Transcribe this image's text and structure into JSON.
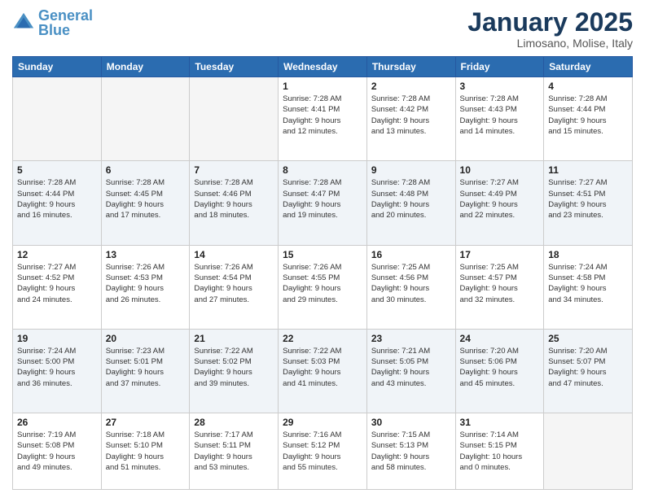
{
  "logo": {
    "text_general": "General",
    "text_blue": "Blue"
  },
  "header": {
    "month_title": "January 2025",
    "location": "Limosano, Molise, Italy"
  },
  "weekdays": [
    "Sunday",
    "Monday",
    "Tuesday",
    "Wednesday",
    "Thursday",
    "Friday",
    "Saturday"
  ],
  "weeks": [
    {
      "days": [
        {
          "num": "",
          "info": ""
        },
        {
          "num": "",
          "info": ""
        },
        {
          "num": "",
          "info": ""
        },
        {
          "num": "1",
          "info": "Sunrise: 7:28 AM\nSunset: 4:41 PM\nDaylight: 9 hours\nand 12 minutes."
        },
        {
          "num": "2",
          "info": "Sunrise: 7:28 AM\nSunset: 4:42 PM\nDaylight: 9 hours\nand 13 minutes."
        },
        {
          "num": "3",
          "info": "Sunrise: 7:28 AM\nSunset: 4:43 PM\nDaylight: 9 hours\nand 14 minutes."
        },
        {
          "num": "4",
          "info": "Sunrise: 7:28 AM\nSunset: 4:44 PM\nDaylight: 9 hours\nand 15 minutes."
        }
      ]
    },
    {
      "days": [
        {
          "num": "5",
          "info": "Sunrise: 7:28 AM\nSunset: 4:44 PM\nDaylight: 9 hours\nand 16 minutes."
        },
        {
          "num": "6",
          "info": "Sunrise: 7:28 AM\nSunset: 4:45 PM\nDaylight: 9 hours\nand 17 minutes."
        },
        {
          "num": "7",
          "info": "Sunrise: 7:28 AM\nSunset: 4:46 PM\nDaylight: 9 hours\nand 18 minutes."
        },
        {
          "num": "8",
          "info": "Sunrise: 7:28 AM\nSunset: 4:47 PM\nDaylight: 9 hours\nand 19 minutes."
        },
        {
          "num": "9",
          "info": "Sunrise: 7:28 AM\nSunset: 4:48 PM\nDaylight: 9 hours\nand 20 minutes."
        },
        {
          "num": "10",
          "info": "Sunrise: 7:27 AM\nSunset: 4:49 PM\nDaylight: 9 hours\nand 22 minutes."
        },
        {
          "num": "11",
          "info": "Sunrise: 7:27 AM\nSunset: 4:51 PM\nDaylight: 9 hours\nand 23 minutes."
        }
      ]
    },
    {
      "days": [
        {
          "num": "12",
          "info": "Sunrise: 7:27 AM\nSunset: 4:52 PM\nDaylight: 9 hours\nand 24 minutes."
        },
        {
          "num": "13",
          "info": "Sunrise: 7:26 AM\nSunset: 4:53 PM\nDaylight: 9 hours\nand 26 minutes."
        },
        {
          "num": "14",
          "info": "Sunrise: 7:26 AM\nSunset: 4:54 PM\nDaylight: 9 hours\nand 27 minutes."
        },
        {
          "num": "15",
          "info": "Sunrise: 7:26 AM\nSunset: 4:55 PM\nDaylight: 9 hours\nand 29 minutes."
        },
        {
          "num": "16",
          "info": "Sunrise: 7:25 AM\nSunset: 4:56 PM\nDaylight: 9 hours\nand 30 minutes."
        },
        {
          "num": "17",
          "info": "Sunrise: 7:25 AM\nSunset: 4:57 PM\nDaylight: 9 hours\nand 32 minutes."
        },
        {
          "num": "18",
          "info": "Sunrise: 7:24 AM\nSunset: 4:58 PM\nDaylight: 9 hours\nand 34 minutes."
        }
      ]
    },
    {
      "days": [
        {
          "num": "19",
          "info": "Sunrise: 7:24 AM\nSunset: 5:00 PM\nDaylight: 9 hours\nand 36 minutes."
        },
        {
          "num": "20",
          "info": "Sunrise: 7:23 AM\nSunset: 5:01 PM\nDaylight: 9 hours\nand 37 minutes."
        },
        {
          "num": "21",
          "info": "Sunrise: 7:22 AM\nSunset: 5:02 PM\nDaylight: 9 hours\nand 39 minutes."
        },
        {
          "num": "22",
          "info": "Sunrise: 7:22 AM\nSunset: 5:03 PM\nDaylight: 9 hours\nand 41 minutes."
        },
        {
          "num": "23",
          "info": "Sunrise: 7:21 AM\nSunset: 5:05 PM\nDaylight: 9 hours\nand 43 minutes."
        },
        {
          "num": "24",
          "info": "Sunrise: 7:20 AM\nSunset: 5:06 PM\nDaylight: 9 hours\nand 45 minutes."
        },
        {
          "num": "25",
          "info": "Sunrise: 7:20 AM\nSunset: 5:07 PM\nDaylight: 9 hours\nand 47 minutes."
        }
      ]
    },
    {
      "days": [
        {
          "num": "26",
          "info": "Sunrise: 7:19 AM\nSunset: 5:08 PM\nDaylight: 9 hours\nand 49 minutes."
        },
        {
          "num": "27",
          "info": "Sunrise: 7:18 AM\nSunset: 5:10 PM\nDaylight: 9 hours\nand 51 minutes."
        },
        {
          "num": "28",
          "info": "Sunrise: 7:17 AM\nSunset: 5:11 PM\nDaylight: 9 hours\nand 53 minutes."
        },
        {
          "num": "29",
          "info": "Sunrise: 7:16 AM\nSunset: 5:12 PM\nDaylight: 9 hours\nand 55 minutes."
        },
        {
          "num": "30",
          "info": "Sunrise: 7:15 AM\nSunset: 5:13 PM\nDaylight: 9 hours\nand 58 minutes."
        },
        {
          "num": "31",
          "info": "Sunrise: 7:14 AM\nSunset: 5:15 PM\nDaylight: 10 hours\nand 0 minutes."
        },
        {
          "num": "",
          "info": ""
        }
      ]
    }
  ]
}
